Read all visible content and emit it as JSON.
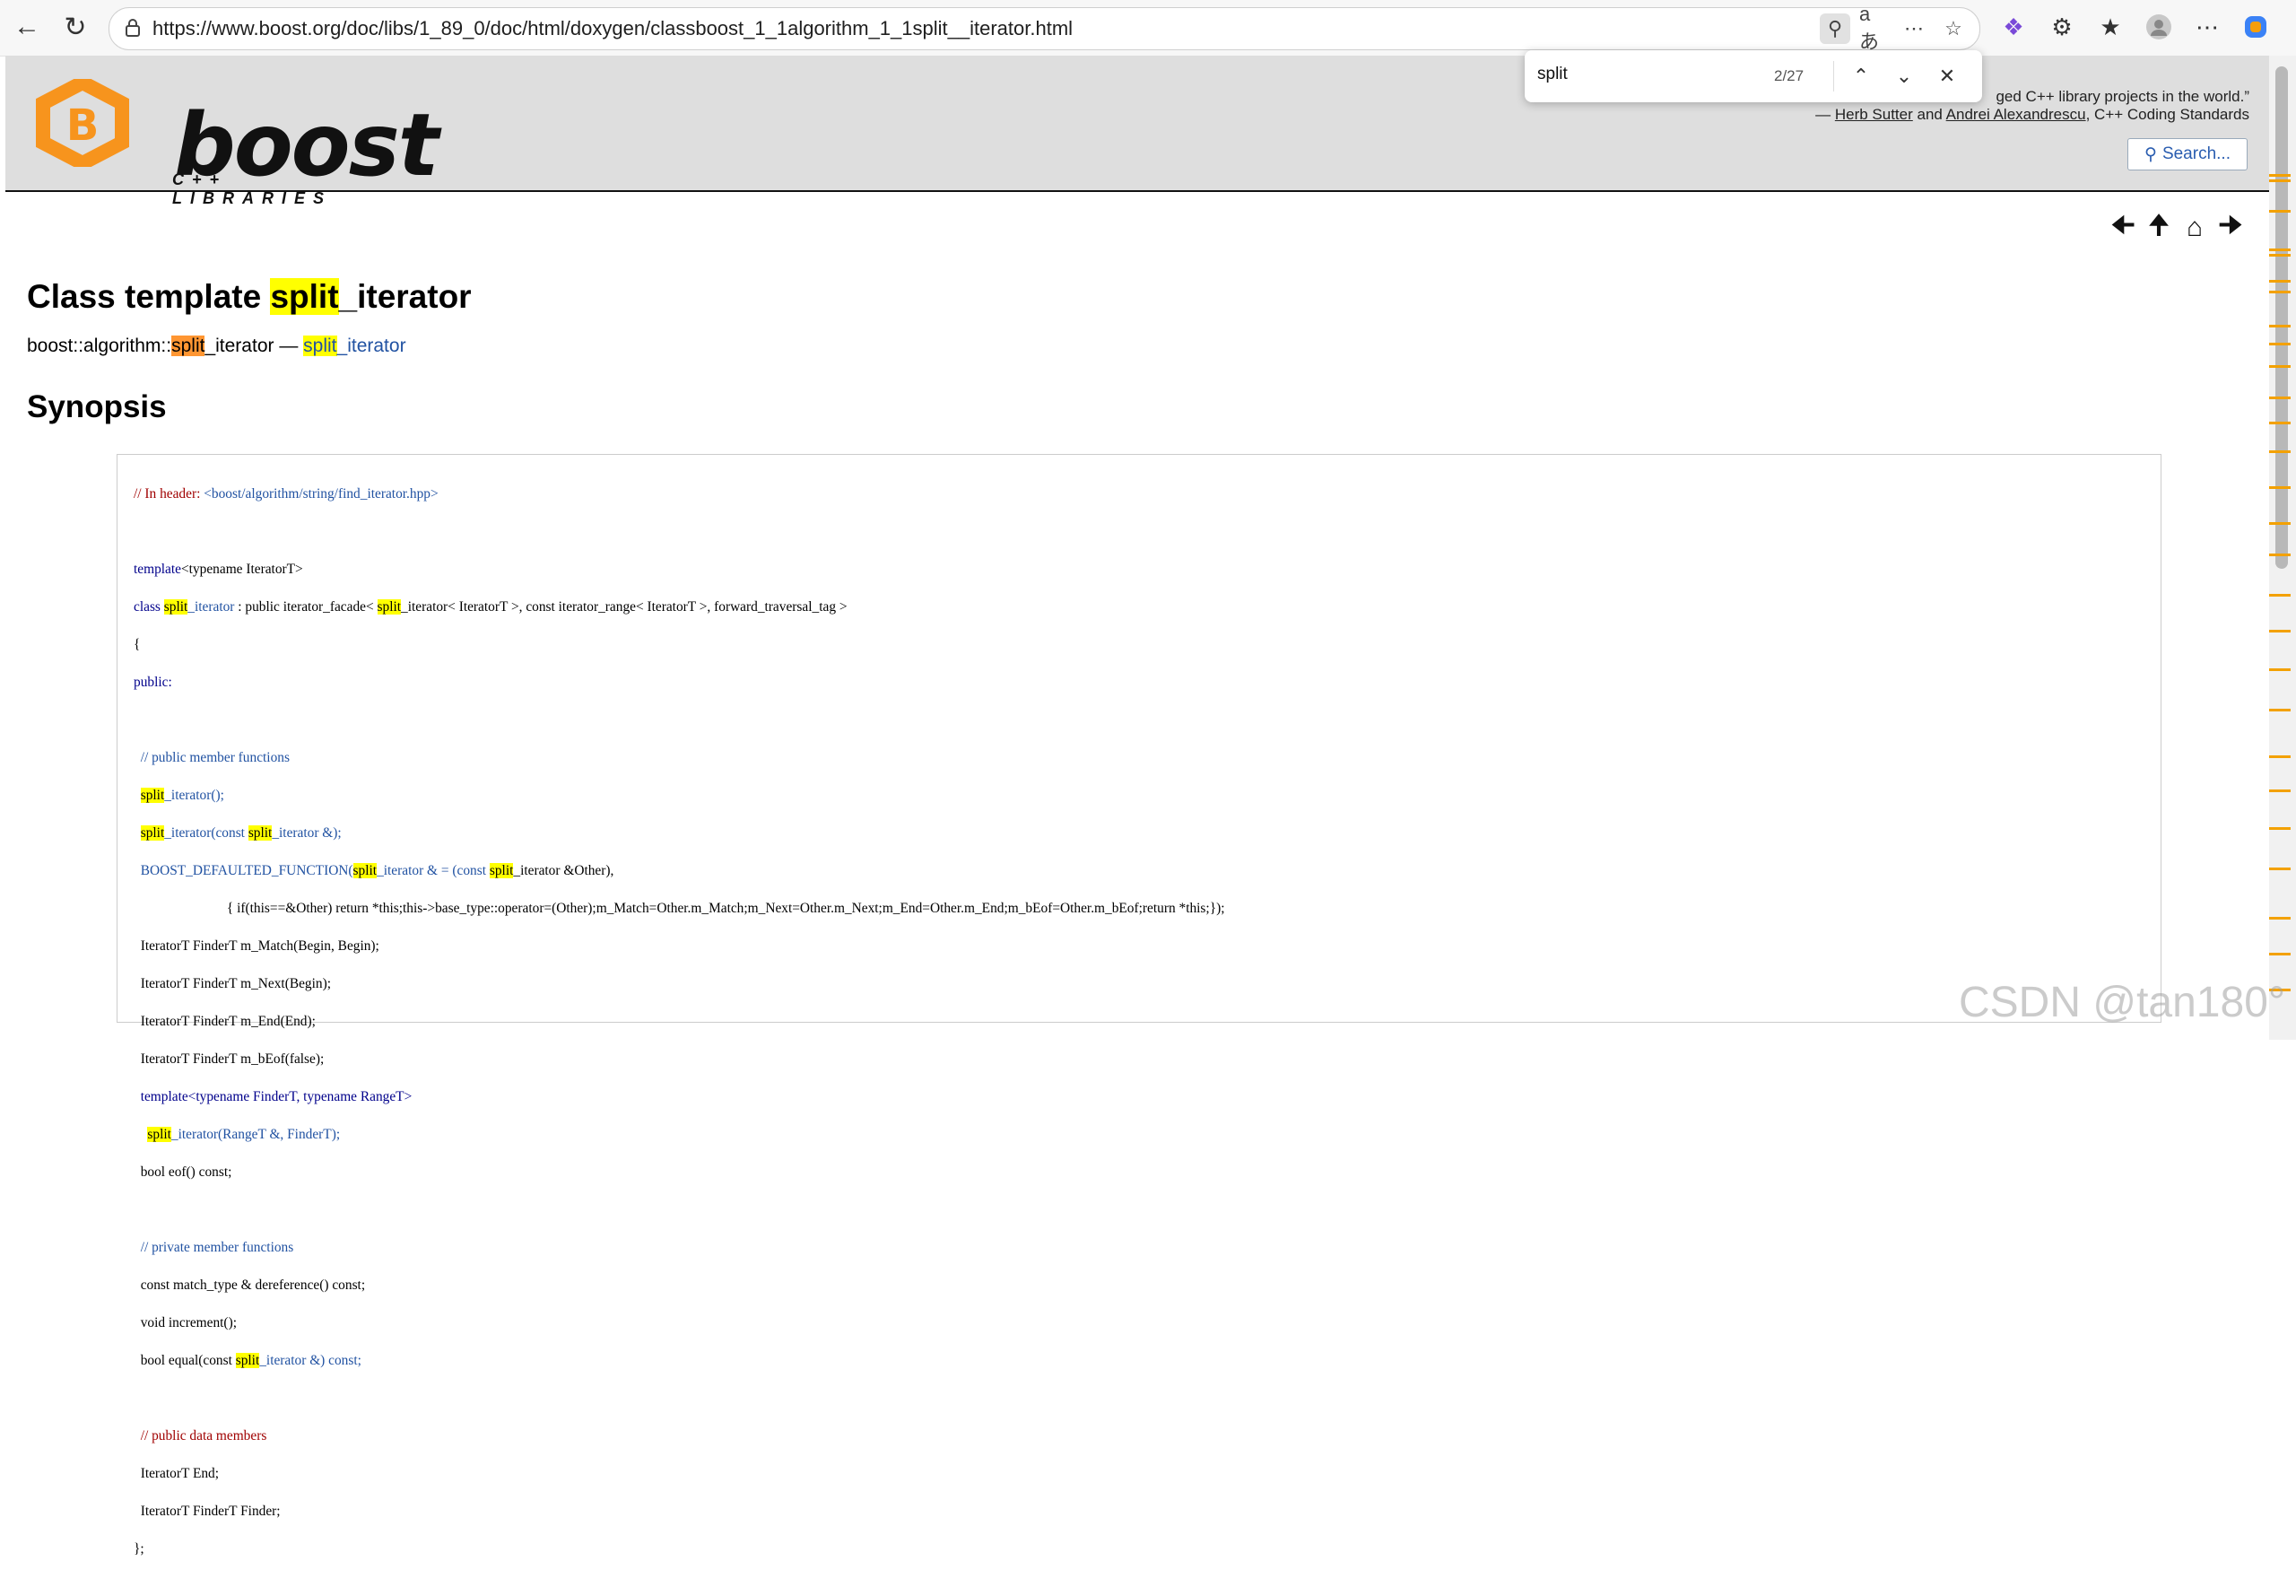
{
  "browser": {
    "url": "https://www.boost.org/doc/libs/1_89_0/doc/html/doxygen/classboost_1_1algorithm_1_1split__iterator.html",
    "icons": [
      "back-icon",
      "refresh-icon",
      "lock-icon",
      "translate-icon",
      "read-aloud-icon",
      "extension-icon",
      "favorite-icon",
      "profile-icon",
      "more-icon",
      "copilot-icon",
      "ai-icon",
      "extensions-icon",
      "favorites-list-icon"
    ]
  },
  "find": {
    "query": "split",
    "count": "2/27"
  },
  "header": {
    "logo_word": "boost",
    "logo_sub": "C++ LIBRARIES",
    "quote_line1": "…one of the most highly regarded and expertly designed C++ library projects in the world.”",
    "quote_line1_visible": "ged C++ library projects in the world.”",
    "quote_line2_pre": "— ",
    "quote_author1": "Herb Sutter",
    "quote_and": " and ",
    "quote_author2": "Andrei Alexandrescu",
    "quote_book": ", C++ Coding Standards",
    "search_label": "Search..."
  },
  "doc": {
    "title_pre": "Class template ",
    "title_hl": "split",
    "title_post": "_iterator",
    "subtitle_pre": "boost::algorithm::",
    "subtitle_hl": "split",
    "subtitle_mid": "_iterator — ",
    "subtitle_link_hl": "split",
    "subtitle_link_post": "_iterator",
    "synopsis": "Synopsis"
  },
  "code": {
    "l1_comment": "// In header: ",
    "l1_include": "<boost/algorithm/string/find_iterator.hpp>",
    "l3_template": "template",
    "l3_rest": "<typename IteratorT>",
    "l4_class": "class ",
    "l4_split": "split",
    "l4_iter": "_iterator",
    "l4_rest": " : public iterator_facade< ",
    "l4_split2": "split",
    "l4_rest2": "_iterator< IteratorT >, const iterator_range< IteratorT >, forward_traversal_tag >",
    "l5": "{",
    "l6": "public:",
    "c1": "  // public member functions",
    "f1": "_iterator();",
    "f2a": "_iterator(const ",
    "f2b": "_iterator &);",
    "f3a": "  BOOST_DEFAULTED_FUNCTION(",
    "f3b": "_iterator & = (const ",
    "f3c": "_iterator &Other),",
    "f4": "                           { if(this==&Other) return *this;this->base_type::operator=(Other);m_Match=Other.m_Match;m_Next=Other.m_Next;m_End=Other.m_End;m_bEof=Other.m_bEof;return *this;});",
    "f5": "  IteratorT FinderT m_Match(Begin, Begin);",
    "f6": "  IteratorT FinderT m_Next(Begin);",
    "f7": "  IteratorT FinderT m_End(End);",
    "f8": "  IteratorT FinderT m_bEof(false);",
    "f9": "  template<typename FinderT, typename RangeT>",
    "f10": "_iterator(RangeT &, FinderT);",
    "f11": "  bool eof() const;",
    "c2": "  // private member functions",
    "p1": "  const match_type & dereference() const;",
    "p2": "  void increment();",
    "p3a": "  bool equal(const ",
    "p3b": "_iterator &) const;",
    "c3": "  // public data members",
    "d1": "  IteratorT End;",
    "d2": "  IteratorT FinderT Finder;",
    "end": "};",
    "split": "split"
  },
  "watermark": "CSDN @tan180°"
}
